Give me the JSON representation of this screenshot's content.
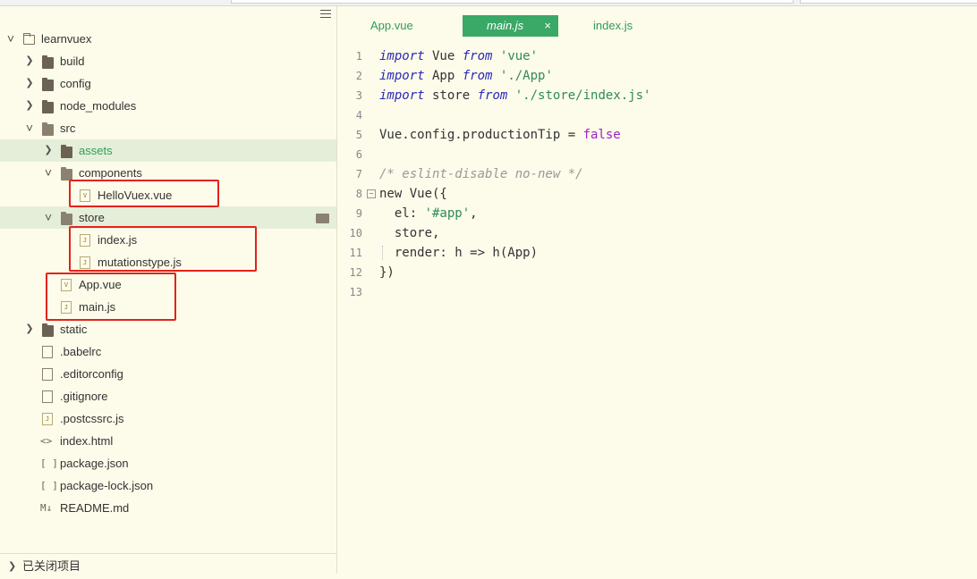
{
  "sidebar": {
    "menu_icon": "hamburger-menu-icon",
    "tree": [
      {
        "id": "learnvuex",
        "label": "learnvuex",
        "depth": 0,
        "kind": "project",
        "expanded": true
      },
      {
        "id": "build",
        "label": "build",
        "depth": 1,
        "kind": "folder",
        "expanded": false
      },
      {
        "id": "config",
        "label": "config",
        "depth": 1,
        "kind": "folder",
        "expanded": false
      },
      {
        "id": "node_modules",
        "label": "node_modules",
        "depth": 1,
        "kind": "folder",
        "expanded": false
      },
      {
        "id": "src",
        "label": "src",
        "depth": 1,
        "kind": "folder",
        "expanded": true
      },
      {
        "id": "assets",
        "label": "assets",
        "depth": 2,
        "kind": "folder",
        "expanded": false,
        "highlighted": true
      },
      {
        "id": "components",
        "label": "components",
        "depth": 2,
        "kind": "folder",
        "expanded": true
      },
      {
        "id": "hellovuex",
        "label": "HelloVuex.vue",
        "depth": 3,
        "kind": "vue"
      },
      {
        "id": "store",
        "label": "store",
        "depth": 2,
        "kind": "folder",
        "expanded": true,
        "highlighted": true
      },
      {
        "id": "store_index",
        "label": "index.js",
        "depth": 3,
        "kind": "js"
      },
      {
        "id": "mutationstype",
        "label": "mutationstype.js",
        "depth": 3,
        "kind": "js"
      },
      {
        "id": "appvue",
        "label": "App.vue",
        "depth": 2,
        "kind": "vue"
      },
      {
        "id": "mainjs",
        "label": "main.js",
        "depth": 2,
        "kind": "js"
      },
      {
        "id": "static",
        "label": "static",
        "depth": 1,
        "kind": "folder",
        "expanded": false
      },
      {
        "id": "babelrc",
        "label": ".babelrc",
        "depth": 1,
        "kind": "plain"
      },
      {
        "id": "editorconfig",
        "label": ".editorconfig",
        "depth": 1,
        "kind": "plain"
      },
      {
        "id": "gitignore",
        "label": ".gitignore",
        "depth": 1,
        "kind": "plain"
      },
      {
        "id": "postcssrc",
        "label": ".postcssrc.js",
        "depth": 1,
        "kind": "js"
      },
      {
        "id": "indexhtml",
        "label": "index.html",
        "depth": 1,
        "kind": "html"
      },
      {
        "id": "packagejson",
        "label": "package.json",
        "depth": 1,
        "kind": "json"
      },
      {
        "id": "packagelock",
        "label": "package-lock.json",
        "depth": 1,
        "kind": "json"
      },
      {
        "id": "readme",
        "label": "README.md",
        "depth": 1,
        "kind": "md"
      }
    ],
    "closed_projects_label": "已关闭项目"
  },
  "editor": {
    "tabs": [
      {
        "label": "App.vue",
        "active": false
      },
      {
        "label": "main.js",
        "active": true
      },
      {
        "label": "index.js",
        "active": false
      }
    ],
    "close_glyph": "×",
    "lines": [
      {
        "n": "1",
        "html": "<span class='kw'>import</span> Vue <span class='kw'>from</span> <span class='str'>'vue'</span>"
      },
      {
        "n": "2",
        "html": "<span class='kw'>import</span> App <span class='kw'>from</span> <span class='str'>'./App'</span>"
      },
      {
        "n": "3",
        "html": "<span class='kw'>import</span> store <span class='kw'>from</span> <span class='str'>'./store/index.js'</span>"
      },
      {
        "n": "4",
        "html": ""
      },
      {
        "n": "5",
        "html": "Vue.config.productionTip = <span class='bool'>false</span>"
      },
      {
        "n": "6",
        "html": ""
      },
      {
        "n": "7",
        "html": "<span class='cm'>/* eslint-disable no-new */</span>"
      },
      {
        "n": "8",
        "html": "new Vue({",
        "fold": true
      },
      {
        "n": "9",
        "html": "  el: <span class='str'>'#app'</span>,"
      },
      {
        "n": "10",
        "html": "  store,"
      },
      {
        "n": "11",
        "html": "  render: h =&gt; h(App)"
      },
      {
        "n": "12",
        "html": "})"
      },
      {
        "n": "13",
        "html": ""
      }
    ]
  }
}
